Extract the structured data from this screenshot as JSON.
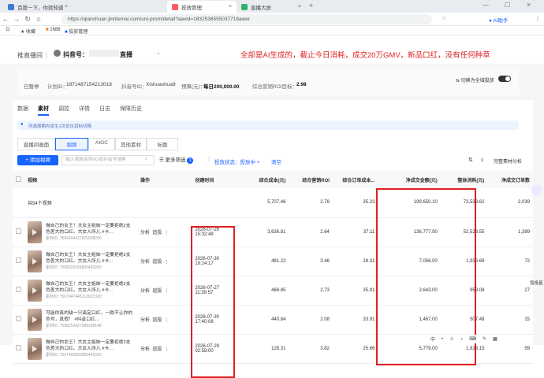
{
  "browser": {
    "tabs": [
      {
        "label": "百度一下，你就知道",
        "active": false,
        "color": "#3a7bd5"
      },
      {
        "label": "投放管理",
        "active": true,
        "color": "#ff5a5f"
      },
      {
        "label": "直播大屏",
        "active": false,
        "color": "#2fb36b"
      }
    ],
    "url": "https://qianchuan.jinritemai.com/uni-prom/detail?aavid=1832538555037718awer",
    "ai_label": "AI助手",
    "bookmarks": [
      "收藏",
      "1688",
      "投放管理"
    ]
  },
  "header": {
    "breadcrumb": "推直播间",
    "account_prefix": "抖音号：",
    "account_suffix": "直播",
    "annotation": "全部是AI生成的，截止今日消耗，成交20万GMV，新品口红，没有任何种草"
  },
  "info": {
    "status": "已暂停",
    "plan_label": "计划ID：",
    "plan_id": "1871487154213018",
    "douyin_label": "抖音号ID：",
    "douyin_id": "Xishuashua9",
    "budget_label": "预算(元)：",
    "budget_value": "每日200,000.00",
    "roi_label": "综合营销ROI目标：",
    "roi_value": "2.98",
    "switch_label": "切换为全域投放"
  },
  "tabs": [
    "数据",
    "素材",
    "调控",
    "详情",
    "日志",
    "保障历史"
  ],
  "active_tab": 1,
  "notice": "所选周期内发生1次优化目标切换",
  "subtabs": [
    "直播间画面",
    "视频",
    "AIGC",
    "其他素材",
    "标题"
  ],
  "active_subtab": 1,
  "toolbar": {
    "add_button": "添加视频",
    "search_placeholder": "输入视频名称/ID或抖音号搜索",
    "more_filter": "更多筛选",
    "filter_count": "1",
    "status_label": "投放状态：投放中",
    "clear_label": "清空",
    "analysis_label": "完整素材分析"
  },
  "table": {
    "columns": [
      "视频",
      "操作",
      "创建时间",
      "综合成本(元)",
      "综合营销ROI",
      "综合订单成本...",
      "净成交金额(元)",
      "整体消耗(元)",
      "净成交订单数"
    ],
    "summary": {
      "label": "共54个视频",
      "cost": "5,707.46",
      "roi": "2.78",
      "order_cost": "35.23",
      "gmv": "199,650.10",
      "spend": "73,533.62",
      "orders": "2,039"
    },
    "rows": [
      {
        "title": "做自己的女王！大女主姐妹一定要拒绝2支色差大的口红。大女人所儿 #卡...",
        "id": "素材ID: 7566494427621508200",
        "created_date": "2026-07-26",
        "created_time": "15:32:48",
        "cost": "3,636.81",
        "roi": "2.64",
        "order_cost": "37.11",
        "gmv": "136,777.90",
        "spend": "52,523.55",
        "orders": "1,399"
      },
      {
        "title": "做自己的女王！大女主姐妹一定要拒绝2支色差大的口红。大女人所儿 #卡...",
        "id": "素材ID: 7568226169800493290",
        "created_date": "2026-07-30",
        "created_time": "19:14:17",
        "cost": "481.22",
        "roi": "3.46",
        "order_cost": "28.31",
        "gmv": "7,056.00",
        "spend": "1,936.69",
        "orders": "72"
      },
      {
        "title": "做自己的女王！大女主姐妹一定要拒绝2支色差大的口红。大女人所儿 #卡...",
        "id": "素材ID: 7567047445213921320",
        "created_date": "2026-07-27",
        "created_time": "11:39:57",
        "cost": "466.85",
        "roi": "2.73",
        "order_cost": "35.91",
        "gmv": "2,643.00",
        "spend": "959.08",
        "orders": "27"
      },
      {
        "title": "可能你真的缺一只高定口红，一款不让你的色号，真假！ #抖音口红...",
        "id": "素材ID: 7568253427588188148",
        "created_date": "2026-07-30",
        "created_time": "17:40:08",
        "cost": "440.84",
        "roi": "2.08",
        "order_cost": "33.91",
        "gmv": "1,467.00",
        "spend": "507.48",
        "orders": "15"
      },
      {
        "title": "做自己的女王！大女主姐妹一定要拒绝2支色差大的口红。大女人所儿 #卡...",
        "id": "素材ID: 7567405050585443330",
        "created_date": "2026-07-29",
        "created_time": "02:58:00",
        "cost": "128.31",
        "roi": "3.82",
        "order_cost": "25.66",
        "gmv": "5,779.00",
        "spend": "1,813.15",
        "orders": "59"
      }
    ],
    "actions": [
      "分析",
      "追投"
    ]
  },
  "sidebar": {
    "help_label": "智投星"
  }
}
